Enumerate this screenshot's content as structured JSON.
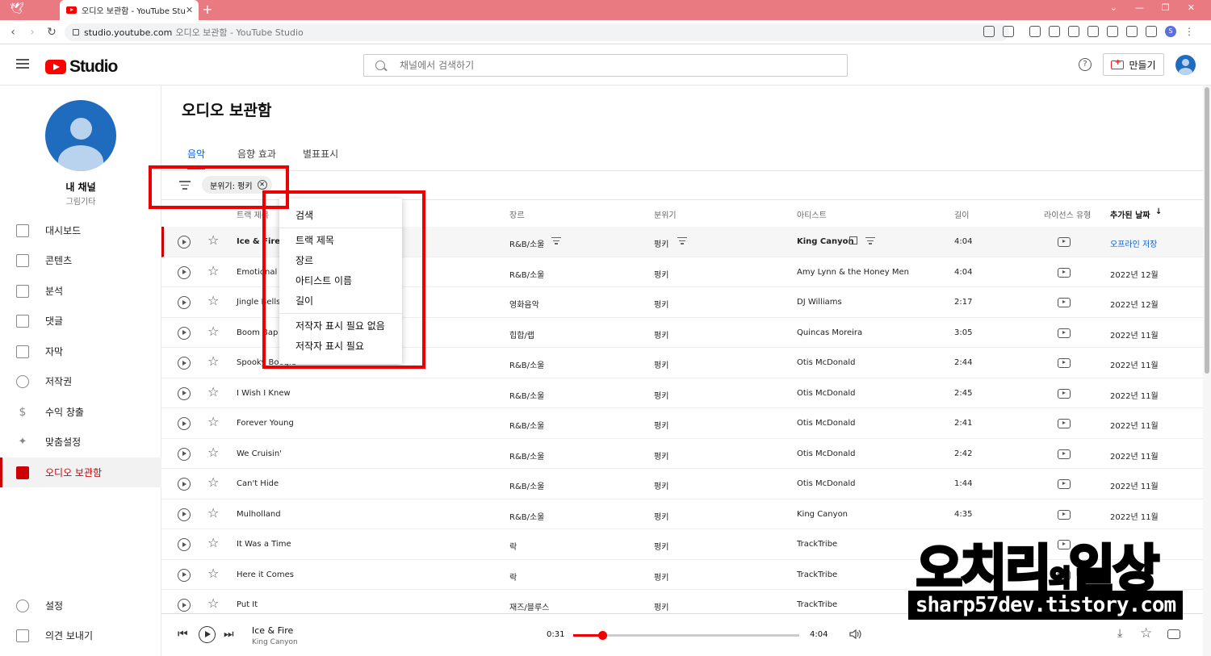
{
  "browser": {
    "tab_title": "오디오 보관함 - YouTube Studio",
    "url_host": "studio.youtube.com",
    "url_title": "오디오 보관함 - YouTube Studio",
    "profile_letter": "S"
  },
  "header": {
    "logo_text": "Studio",
    "search_placeholder": "채널에서 검색하기",
    "create_label": "만들기"
  },
  "sidebar": {
    "channel_name": "내 채널",
    "channel_sub": "그림기타",
    "items": [
      {
        "label": "대시보드",
        "icon": "dashboard-icon"
      },
      {
        "label": "콘텐츠",
        "icon": "content-icon"
      },
      {
        "label": "분석",
        "icon": "analytics-icon"
      },
      {
        "label": "댓글",
        "icon": "comments-icon"
      },
      {
        "label": "자막",
        "icon": "subtitles-icon"
      },
      {
        "label": "저작권",
        "icon": "copyright-icon"
      },
      {
        "label": "수익 창출",
        "icon": "dollar-icon"
      },
      {
        "label": "맞춤설정",
        "icon": "wand-icon"
      },
      {
        "label": "오디오 보관함",
        "icon": "audio-library-icon"
      }
    ],
    "settings_label": "설정",
    "feedback_label": "의견 보내기"
  },
  "main": {
    "title": "오디오 보관함",
    "tabs": [
      "음악",
      "음향 효과",
      "별표표시"
    ],
    "filter_chip": "분위기: 펑키",
    "columns": {
      "title": "트랙 제목",
      "genre": "장르",
      "mood": "분위기",
      "artist": "아티스트",
      "duration": "길이",
      "license": "라이선스 유형",
      "date": "추가된 날짜"
    },
    "rows": [
      {
        "title": "Ice & Fire",
        "genre": "R&B/소울",
        "mood": "펑키",
        "artist": "King Canyon",
        "duration": "4:04",
        "date": "오프라인 저장"
      },
      {
        "title": "Emotional Mess",
        "genre": "R&B/소울",
        "mood": "펑키",
        "artist": "Amy Lynn & the Honey Men",
        "duration": "4:04",
        "date": "2022년 12월"
      },
      {
        "title": "Jingle Bells",
        "genre": "영화음악",
        "mood": "펑키",
        "artist": "DJ Williams",
        "duration": "2:17",
        "date": "2022년 12월"
      },
      {
        "title": "Boom Bap Flick",
        "genre": "힙합/랩",
        "mood": "펑키",
        "artist": "Quincas Moreira",
        "duration": "3:05",
        "date": "2022년 11월"
      },
      {
        "title": "Spooky Boogie",
        "genre": "R&B/소울",
        "mood": "펑키",
        "artist": "Otis McDonald",
        "duration": "2:44",
        "date": "2022년 11월"
      },
      {
        "title": "I Wish I Knew",
        "genre": "R&B/소울",
        "mood": "펑키",
        "artist": "Otis McDonald",
        "duration": "2:45",
        "date": "2022년 11월"
      },
      {
        "title": "Forever Young",
        "genre": "R&B/소울",
        "mood": "펑키",
        "artist": "Otis McDonald",
        "duration": "2:41",
        "date": "2022년 11월"
      },
      {
        "title": "We Cruisin'",
        "genre": "R&B/소울",
        "mood": "펑키",
        "artist": "Otis McDonald",
        "duration": "2:42",
        "date": "2022년 11월"
      },
      {
        "title": "Can't Hide",
        "genre": "R&B/소울",
        "mood": "펑키",
        "artist": "Otis McDonald",
        "duration": "1:44",
        "date": "2022년 11월"
      },
      {
        "title": "Mulholland",
        "genre": "R&B/소울",
        "mood": "펑키",
        "artist": "King Canyon",
        "duration": "4:35",
        "date": "2022년 11월"
      },
      {
        "title": "It Was a Time",
        "genre": "락",
        "mood": "펑키",
        "artist": "TrackTribe",
        "duration": "",
        "date": ""
      },
      {
        "title": "Here it Comes",
        "genre": "락",
        "mood": "펑키",
        "artist": "TrackTribe",
        "duration": "",
        "date": ""
      },
      {
        "title": "Put It",
        "genre": "재즈/블루스",
        "mood": "펑키",
        "artist": "TrackTribe",
        "duration": "",
        "date": ""
      }
    ]
  },
  "filter_menu": {
    "search": "검색",
    "options": [
      "트랙 제목",
      "장르",
      "아티스트 이름",
      "길이"
    ],
    "license_options": [
      "저작자 표시 필요 없음",
      "저작자 표시 필요"
    ]
  },
  "player": {
    "title": "Ice & Fire",
    "artist": "King Canyon",
    "current": "0:31",
    "duration": "4:04",
    "progress_fraction": 0.127
  },
  "watermark": {
    "name_main": "오치리",
    "name_small": "의",
    "name_end": "일상",
    "url": "sharp57dev.tistory.com"
  },
  "colors": {
    "accent": "#065fd4",
    "brand": "#ff0000",
    "highlight_box": "#e00000"
  }
}
